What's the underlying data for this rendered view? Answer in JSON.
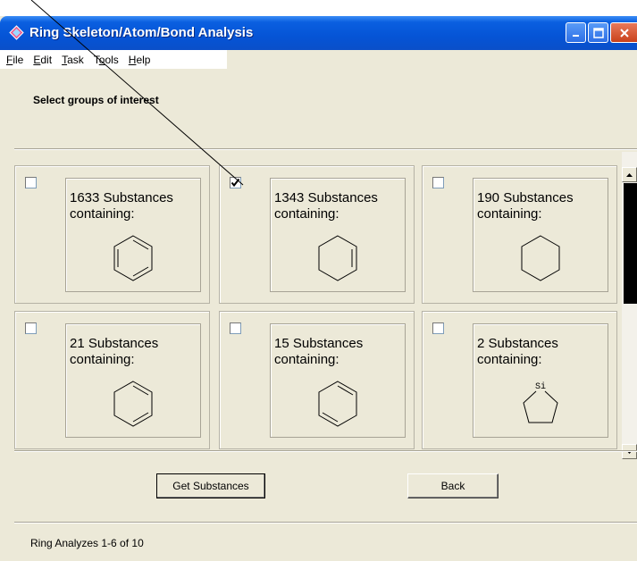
{
  "window": {
    "title": "Ring Skeleton/Atom/Bond Analysis"
  },
  "menu": {
    "items": [
      {
        "mnemonic": "F",
        "rest": "ile"
      },
      {
        "mnemonic": "E",
        "rest": "dit"
      },
      {
        "mnemonic": "T",
        "rest": "ask"
      },
      {
        "pre": "T",
        "mnemonic": "o",
        "rest": "ols"
      },
      {
        "mnemonic": "H",
        "rest": "elp"
      }
    ]
  },
  "heading": "Select groups of interest",
  "groups": [
    {
      "count": "1633 Substances",
      "sub": "containing:",
      "checked": false,
      "structure": "benzene"
    },
    {
      "count": "1343 Substances",
      "sub": "containing:",
      "checked": true,
      "structure": "cyclohexene"
    },
    {
      "count": "190 Substances",
      "sub": "containing:",
      "checked": false,
      "structure": "cyclohexane"
    },
    {
      "count": "21 Substances",
      "sub": "containing:",
      "checked": false,
      "structure": "cyclohexadiene-1-3"
    },
    {
      "count": "15 Substances",
      "sub": "containing:",
      "checked": false,
      "structure": "cyclohexadiene-1-4"
    },
    {
      "count": "2 Substances",
      "sub": "containing:",
      "checked": false,
      "structure": "silacyclopentane",
      "atom_label": "Si"
    }
  ],
  "buttons": {
    "get_substances": "Get Substances",
    "back": "Back"
  },
  "status": "Ring Analyzes 1-6 of 10",
  "colors": {
    "titlebar": "#0554d6",
    "window_bg": "#ece9d8",
    "scroll_thumb": "#000000"
  }
}
